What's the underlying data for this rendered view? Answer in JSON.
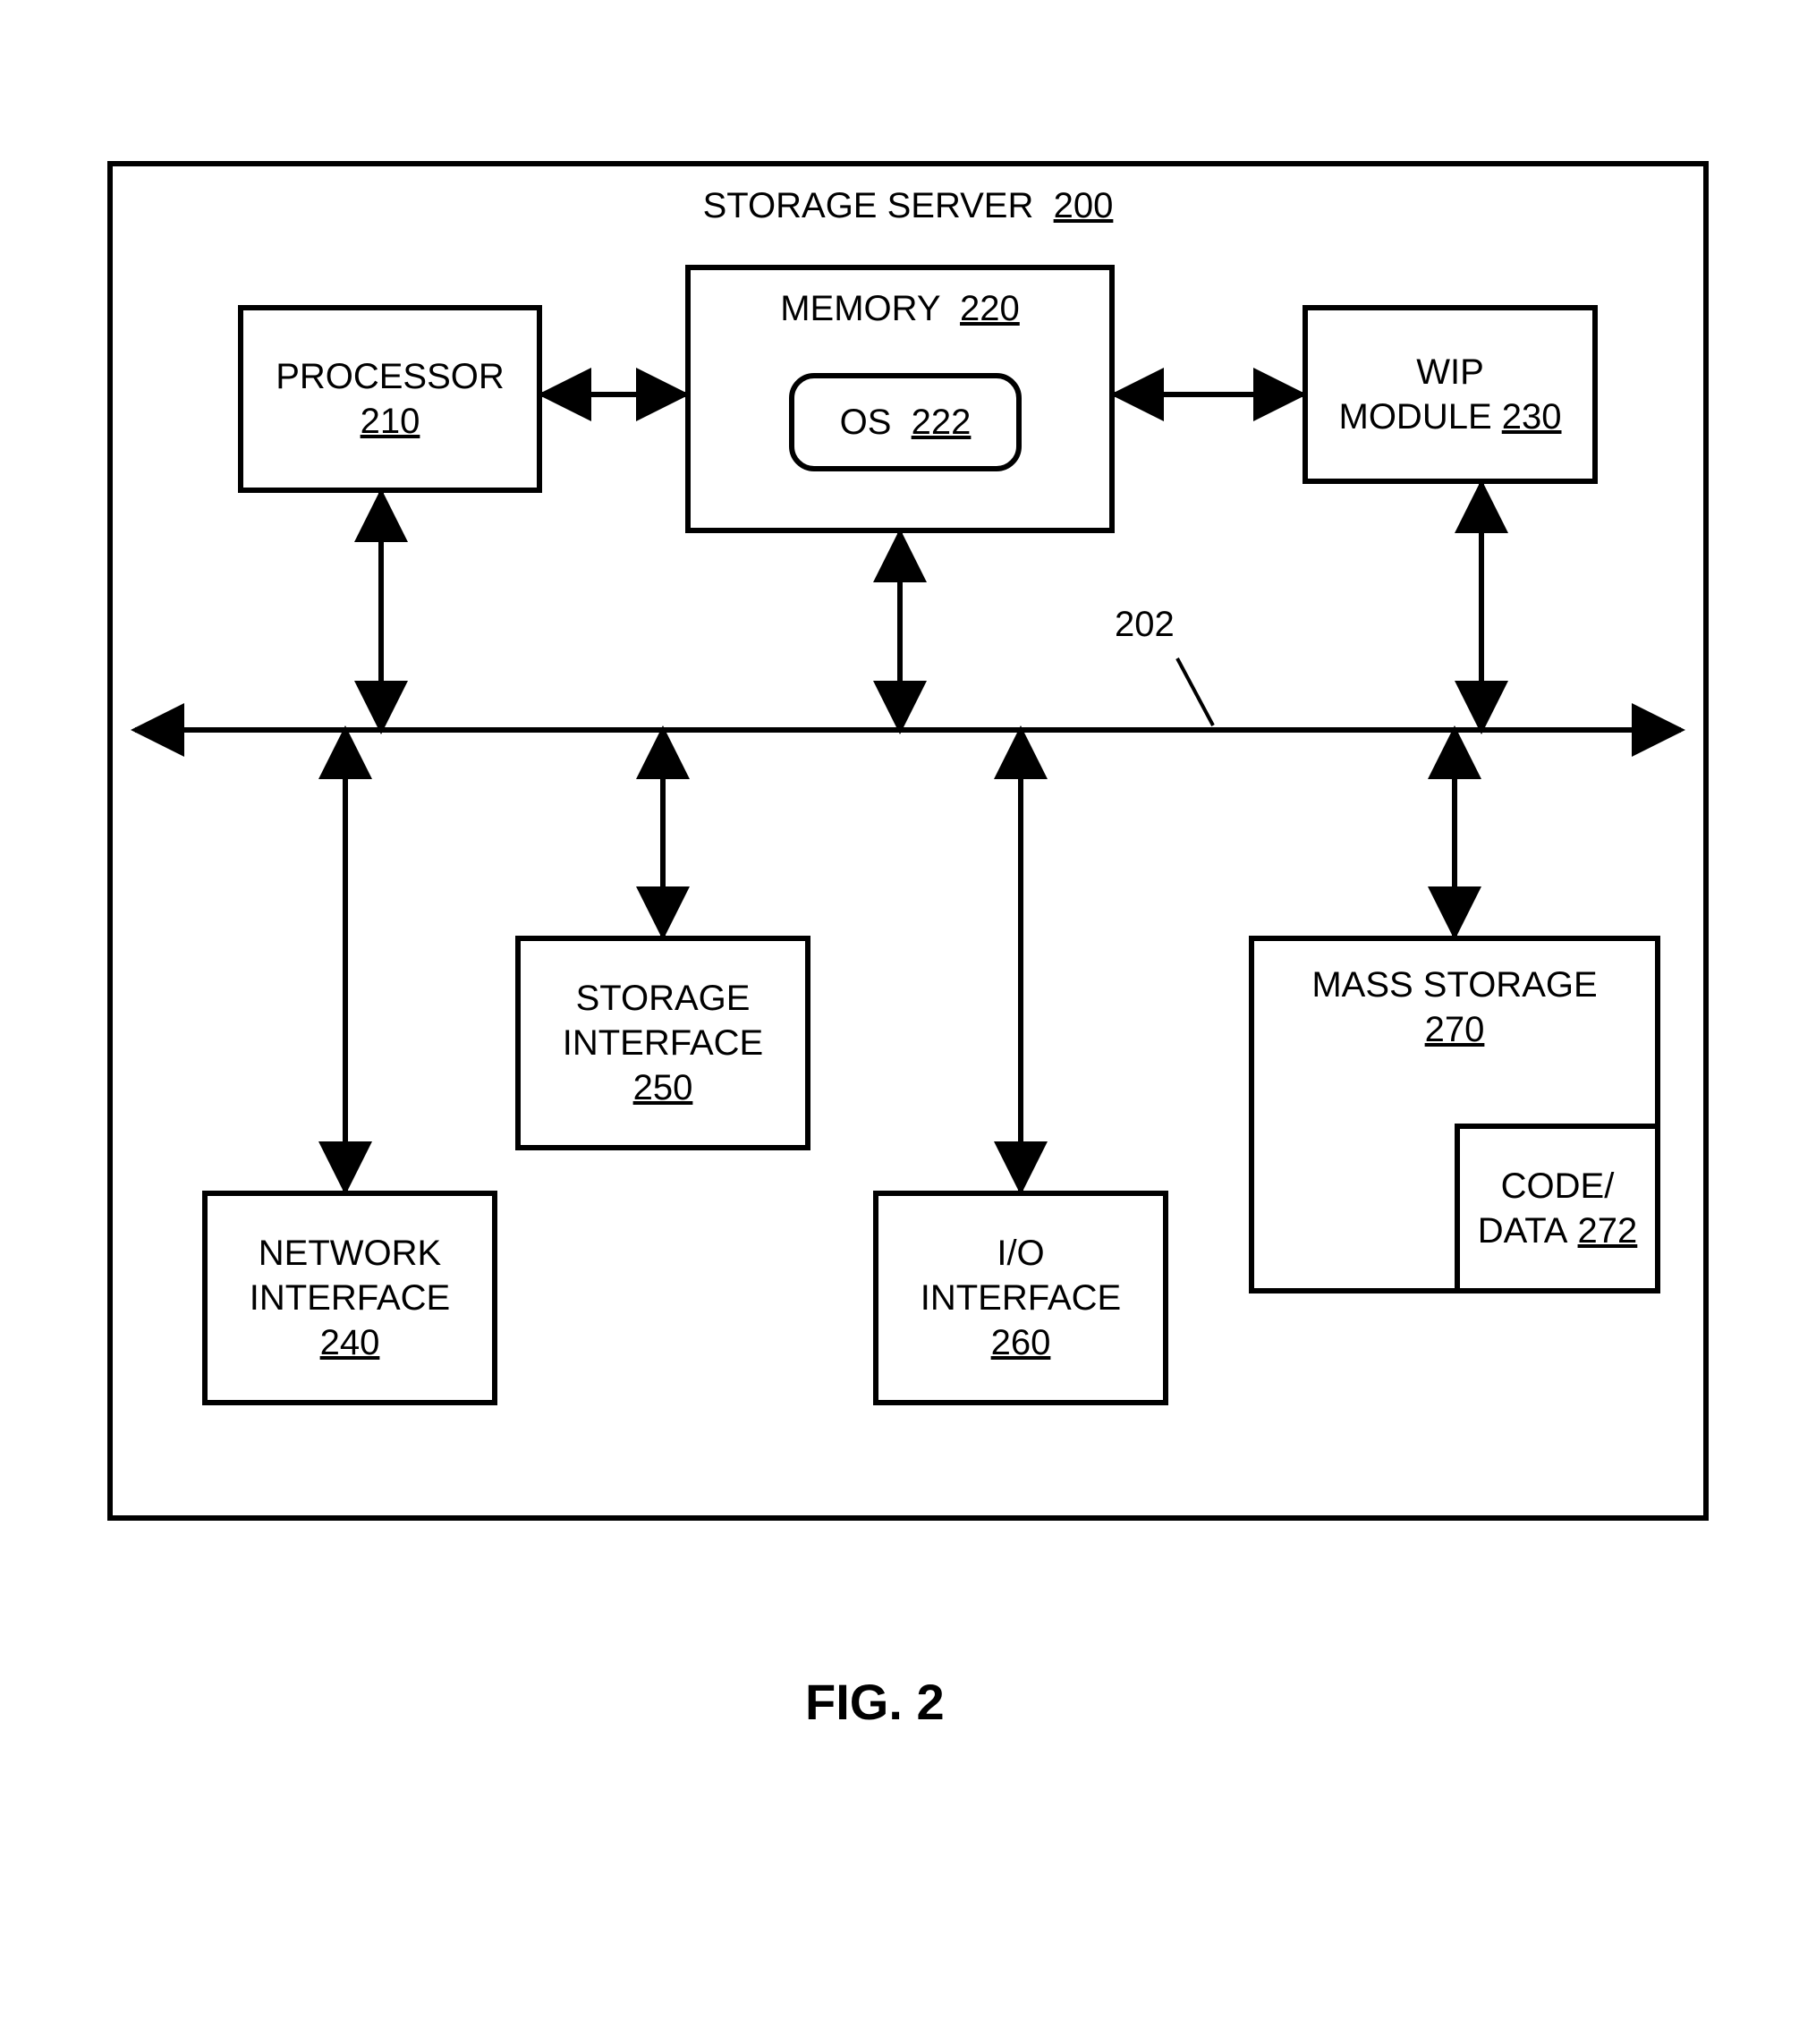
{
  "figure_label": "FIG. 2",
  "container": {
    "name": "STORAGE SERVER",
    "ref": "200"
  },
  "bus": {
    "ref": "202"
  },
  "blocks": {
    "processor": {
      "name": "PROCESSOR",
      "ref": "210"
    },
    "memory": {
      "name": "MEMORY",
      "ref": "220"
    },
    "os": {
      "name": "OS",
      "ref": "222"
    },
    "wip": {
      "name": "WIP MODULE",
      "ref": "230"
    },
    "network_if": {
      "name": "NETWORK INTERFACE",
      "ref": "240"
    },
    "storage_if": {
      "name": "STORAGE INTERFACE",
      "ref": "250"
    },
    "io_if": {
      "name": "I/O INTERFACE",
      "ref": "260"
    },
    "mass_storage": {
      "name": "MASS STORAGE",
      "ref": "270"
    },
    "code_data": {
      "name": "CODE/ DATA",
      "ref": "272"
    }
  }
}
